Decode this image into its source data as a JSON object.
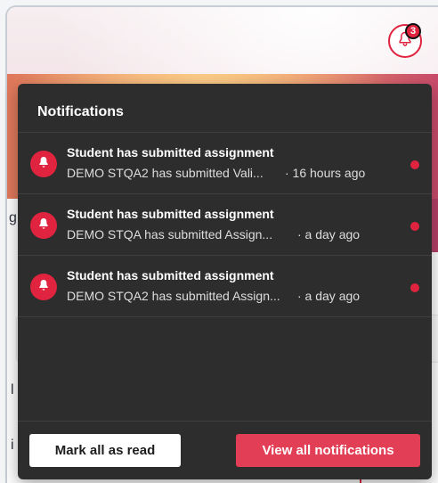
{
  "header": {
    "notification_count": "3"
  },
  "background": {
    "fragment_g": "g",
    "fragment_l": "l",
    "fragment_i": "i"
  },
  "panel": {
    "title": "Notifications",
    "items": [
      {
        "title": "Student has submitted assignment",
        "message": "DEMO STQA2 has submitted Vali...",
        "time": "· 16 hours ago",
        "unread": true
      },
      {
        "title": "Student has submitted assignment",
        "message": "DEMO STQA has submitted Assign...",
        "time": "· a day ago",
        "unread": true
      },
      {
        "title": "Student has submitted assignment",
        "message": "DEMO STQA2 has submitted Assign...",
        "time": "· a day ago",
        "unread": true
      }
    ],
    "mark_all_label": "Mark all as read",
    "view_all_label": "View all notifications"
  },
  "colors": {
    "accent": "#e0243f",
    "panel_bg": "#2d2d2d",
    "view_button": "#e23e55"
  },
  "icons": {
    "bell": "bell-icon"
  }
}
